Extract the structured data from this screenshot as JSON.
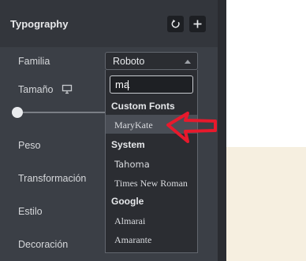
{
  "panel": {
    "title": "Typography",
    "reset_icon": "reset-icon",
    "add_icon": "plus-icon"
  },
  "fields": {
    "family": "Familia",
    "size": "Tamaño",
    "size_icon": "monitor-icon",
    "weight": "Peso",
    "transform": "Transformación",
    "style": "Estilo",
    "decoration": "Decoración"
  },
  "family_select": {
    "selected": "Roboto",
    "search_value": "ma",
    "groups": [
      {
        "name": "Custom Fonts",
        "options": [
          "MaryKate"
        ]
      },
      {
        "name": "System",
        "options": [
          "Tahoma",
          "Times New Roman"
        ]
      },
      {
        "name": "Google",
        "options": [
          "Almarai",
          "Amarante"
        ]
      }
    ],
    "highlighted_option": "MaryKate"
  },
  "colors": {
    "panel_bg": "#3b3f46",
    "header_bg": "#33363c",
    "dropdown_bg": "#2b2d32",
    "highlight_bg": "#4a4e56",
    "annotation_arrow": "#e8192c",
    "canvas_bg": "#f6efe0"
  }
}
